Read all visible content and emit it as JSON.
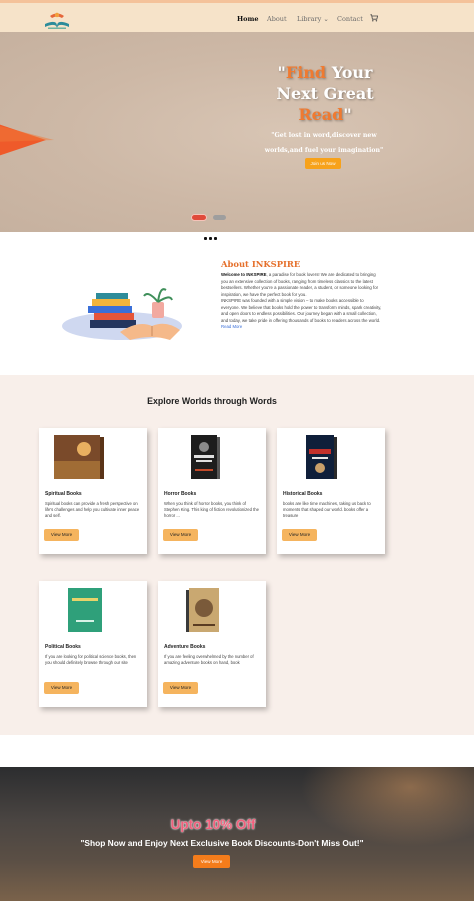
{
  "nav": {
    "logo": "book-logo",
    "links": {
      "home": "Home",
      "about": "About",
      "library": "Library",
      "contact": "Contact"
    },
    "library_caret": "⌄",
    "cart_icon": "cart-icon"
  },
  "hero": {
    "title_open_quote": "\"",
    "title_find": "Find",
    "title_mid": " Your Next Great ",
    "title_read": "Read",
    "title_close_quote": "\"",
    "subtitle": "\"Get lost in word,discover new worlds,and fuel your imagination\"",
    "button": "Join us Now",
    "accent_color": "#f07a30"
  },
  "about": {
    "title": "About INKSPIRE",
    "intro_bold": "Welcome to INKSPIRE",
    "intro_rest": ", a paradise for book lovers! We are dedicated to bringing you an extensive collection of books, ranging from timeless classics to the latest bestsellers. Whether you're a passionate reader, a student, or someone looking for inspiration, we have the perfect book for you.",
    "body": "INKSPIRE was founded with a simple vision – to make books accessible to everyone. We believe that books hold the power to transform minds, spark creativity, and open doors to endless possibilities. Our journey began with a small collection, and today, we take pride in offering thousands of books to readers across the world.",
    "read_more": "Read More"
  },
  "categories": {
    "heading": "Explore Worlds through Words",
    "cards": [
      {
        "title": "Spiritual Books",
        "desc": "Spiritual books can provide a fresh perspective on life's challenges and help you cultivate inner peace and self.",
        "button": "View More",
        "cover": "#7a4a2a",
        "cover_text": "सत्य"
      },
      {
        "title": "Horror Books",
        "desc": "When you think of horror books, you think of Stephen King. This king of fiction revolutionized the horror ...",
        "button": "View More",
        "cover": "#1d1d1d",
        "cover_text": "THE BLACK RIDER"
      },
      {
        "title": "Historical Books",
        "desc": "books are like time machines, taking us back to moments that shaped our world. books offer a treasure",
        "button": "View More",
        "cover": "#0f1f3a",
        "cover_text": "शिवाजी"
      },
      {
        "title": "Political Books",
        "desc": "If you are looking for political science books, then you should definitely browse through our site",
        "button": "View More",
        "cover": "#2fa07a",
        "cover_text": "Nationalism"
      },
      {
        "title": "Adventure Books",
        "desc": "If you are feeling overwhelmed by the number of amazing adventure books on hand, book",
        "button": "View More",
        "cover": "#c9a871",
        "cover_text": "अभिमन्यु"
      }
    ]
  },
  "promo": {
    "title": "Upto 10% Off",
    "subtitle": "\"Shop Now and Enjoy Next Exclusive Book Discounts-Don't Miss Out!\"",
    "button": "View More"
  }
}
